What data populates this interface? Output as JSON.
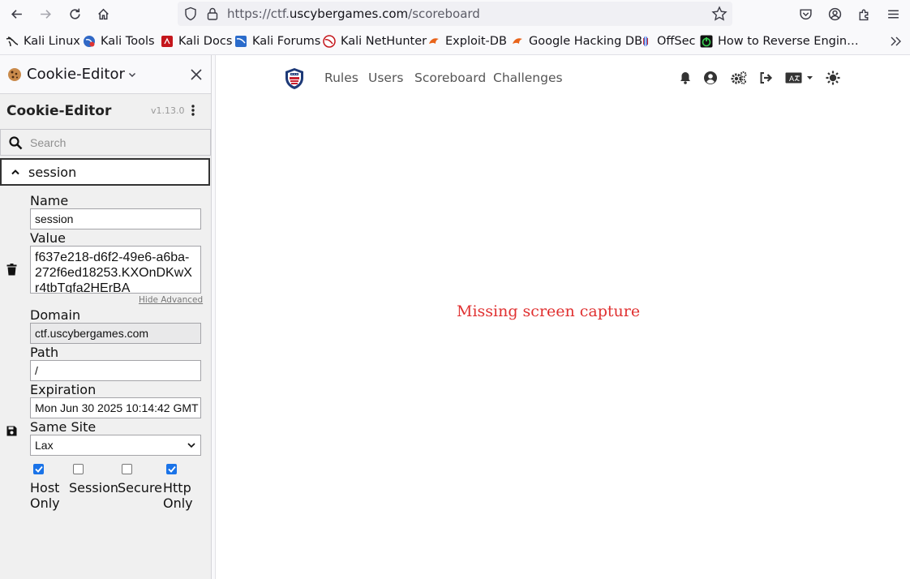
{
  "browser": {
    "url_prefix": "https://ctf.",
    "url_host": "uscybergames.com",
    "url_path": "/scoreboard",
    "bookmarks": [
      {
        "label": "Kali Linux",
        "icon": "kali-dragon-icon"
      },
      {
        "label": "Kali Tools",
        "icon": "kali-tools-icon"
      },
      {
        "label": "Kali Docs",
        "icon": "kali-docs-icon"
      },
      {
        "label": "Kali Forums",
        "icon": "kali-forums-icon"
      },
      {
        "label": "Kali NetHunter",
        "icon": "nethunter-icon"
      },
      {
        "label": "Exploit-DB",
        "icon": "exploit-db-icon"
      },
      {
        "label": "Google Hacking DB",
        "icon": "ghdb-icon"
      },
      {
        "label": "OffSec",
        "icon": "offsec-icon"
      },
      {
        "label": "How to Reverse Engin…",
        "icon": "power-icon"
      }
    ]
  },
  "sidebar": {
    "header_title": "Cookie-Editor",
    "extension_title": "Cookie-Editor",
    "version": "v1.13.0",
    "search_placeholder": "Search",
    "cookie_name_header": "session",
    "fields": {
      "name_label": "Name",
      "name_value": "session",
      "value_label": "Value",
      "value_value": "f637e218-d6f2-49e6-a6ba-272f6ed18253.KXOnDKwXr4tbTgfa2HErBA",
      "hide_advanced": "Hide Advanced",
      "domain_label": "Domain",
      "domain_value": "ctf.uscybergames.com",
      "path_label": "Path",
      "path_value": "/",
      "expiration_label": "Expiration",
      "expiration_value": "Mon Jun 30 2025 10:14:42 GMT",
      "same_site_label": "Same Site",
      "same_site_value": "Lax"
    },
    "checkboxes": [
      {
        "label": "Host Only",
        "checked": true
      },
      {
        "label": "Session",
        "checked": false
      },
      {
        "label": "Secure",
        "checked": false
      },
      {
        "label": "Http Only",
        "checked": true
      }
    ]
  },
  "site": {
    "nav_links": [
      "Rules",
      "Users",
      "Scoreboard",
      "Challenges"
    ],
    "nav_icons": [
      "bell-icon",
      "user-circle-icon",
      "admin-cogs-icon",
      "logout-icon",
      "language-icon",
      "theme-toggle-icon"
    ]
  },
  "main": {
    "message": "Missing screen capture"
  },
  "colors": {
    "message": "#e03131",
    "checkbox_checked": "#1a73e8"
  }
}
